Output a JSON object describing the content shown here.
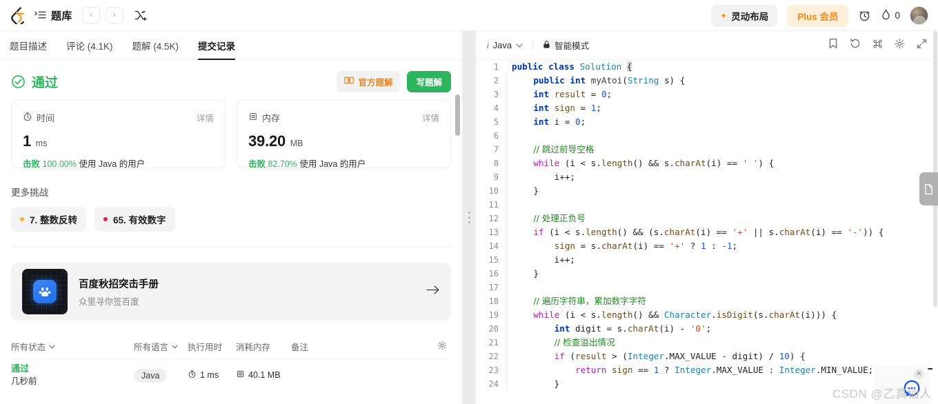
{
  "topbar": {
    "logo_icon": "leetcode-logo-icon",
    "list_icon": "problem-list-icon",
    "nav_title": "题库",
    "prev_label": "‹",
    "next_label": "›",
    "shuffle_icon": "shuffle-icon",
    "layout_label": "灵动布局",
    "spark_icon": "sparkle-icon",
    "plus_label": "Plus 会员",
    "clock_icon": "alarm-clock-icon",
    "drop_icon": "water-drop-icon",
    "drop_count": "0",
    "avatar_icon": "user-avatar"
  },
  "tabs": [
    {
      "label": "题目描述",
      "active": false
    },
    {
      "label": "评论 (4.1K)",
      "active": false
    },
    {
      "label": "题解 (4.5K)",
      "active": false
    },
    {
      "label": "提交记录",
      "active": true
    }
  ],
  "result": {
    "check_icon": "check-circle-icon",
    "status": "通过",
    "official_icon": "book-icon",
    "official_label": "官方题解",
    "write_label": "写题解"
  },
  "stats": [
    {
      "icon": "stopwatch-icon",
      "label": "时间",
      "detail": "详情",
      "value": "1",
      "unit": "ms",
      "beat_prefix": "击败",
      "beat_pct": "100.00%",
      "beat_suffix": "使用 Java 的用户"
    },
    {
      "icon": "memory-chip-icon",
      "label": "内存",
      "detail": "详情",
      "value": "39.20",
      "unit": "MB",
      "beat_prefix": "击败",
      "beat_pct": "82.70%",
      "beat_suffix": "使用 Java 的用户"
    }
  ],
  "more": {
    "title": "更多挑战",
    "chips": [
      {
        "label": "7. 整数反转",
        "dot_color": "#f5b321"
      },
      {
        "label": "65. 有效数字",
        "dot_color": "#ef1b4e"
      }
    ]
  },
  "promo": {
    "thumb_icon": "baidu-bear-paw-icon",
    "title": "百度秋招突击手册",
    "subtitle": "众里寻你签百度",
    "arrow_icon": "arrow-right-icon"
  },
  "submissions": {
    "columns": [
      {
        "label": "所有状态",
        "has_caret": true
      },
      {
        "label": "所有语言",
        "has_caret": true
      },
      {
        "label": "执行用时",
        "has_caret": false
      },
      {
        "label": "消耗内存",
        "has_caret": false
      },
      {
        "label": "备注",
        "has_caret": false
      }
    ],
    "settings_icon": "gear-icon",
    "rows": [
      {
        "status": "通过",
        "time_ago": "几秒前",
        "language": "Java",
        "runtime_icon": "stopwatch-icon",
        "runtime": "1 ms",
        "memory_icon": "memory-chip-icon",
        "memory": "40.1 MB",
        "note": ""
      }
    ]
  },
  "editor": {
    "info_icon": "info-icon",
    "language": "Java",
    "caret_icon": "chevron-down-icon",
    "lock_icon": "lock-icon",
    "mode_label": "智能模式",
    "tools": [
      "bookmark-icon",
      "reset-icon",
      "command-icon",
      "gear-icon",
      "expand-icon"
    ],
    "doc_tab_icon": "document-icon",
    "code_lines": [
      {
        "n": "1",
        "tokens": [
          {
            "t": "kw2",
            "v": "public "
          },
          {
            "t": "kw2",
            "v": "class "
          },
          {
            "t": "cls",
            "v": "Solution "
          },
          {
            "t": "cursor",
            "v": "{"
          }
        ]
      },
      {
        "n": "2",
        "tokens": [
          {
            "t": "pln",
            "v": "    "
          },
          {
            "t": "kw2",
            "v": "public "
          },
          {
            "t": "kw2",
            "v": "int "
          },
          {
            "t": "fn",
            "v": "myAtoi"
          },
          {
            "t": "pln",
            "v": "("
          },
          {
            "t": "cls",
            "v": "String"
          },
          {
            "t": "pln",
            "v": " s) {"
          }
        ]
      },
      {
        "n": "3",
        "tokens": [
          {
            "t": "pln",
            "v": "    "
          },
          {
            "t": "kw2",
            "v": "int "
          },
          {
            "t": "var",
            "v": "result"
          },
          {
            "t": "pln",
            "v": " = "
          },
          {
            "t": "num",
            "v": "0"
          },
          {
            "t": "pln",
            "v": ";"
          }
        ]
      },
      {
        "n": "4",
        "tokens": [
          {
            "t": "pln",
            "v": "    "
          },
          {
            "t": "kw2",
            "v": "int "
          },
          {
            "t": "var",
            "v": "sign"
          },
          {
            "t": "pln",
            "v": " = "
          },
          {
            "t": "num",
            "v": "1"
          },
          {
            "t": "pln",
            "v": ";"
          }
        ]
      },
      {
        "n": "5",
        "tokens": [
          {
            "t": "pln",
            "v": "    "
          },
          {
            "t": "kw2",
            "v": "int "
          },
          {
            "t": "pln",
            "v": "i = "
          },
          {
            "t": "num",
            "v": "0"
          },
          {
            "t": "pln",
            "v": ";"
          }
        ]
      },
      {
        "n": "6",
        "tokens": []
      },
      {
        "n": "7",
        "tokens": [
          {
            "t": "pln",
            "v": "    "
          },
          {
            "t": "cmt",
            "v": "// 跳过前导空格"
          }
        ]
      },
      {
        "n": "8",
        "tokens": [
          {
            "t": "pln",
            "v": "    "
          },
          {
            "t": "kw",
            "v": "while "
          },
          {
            "t": "pln",
            "v": "(i < s."
          },
          {
            "t": "var",
            "v": "length"
          },
          {
            "t": "pln",
            "v": "() && s."
          },
          {
            "t": "var",
            "v": "charAt"
          },
          {
            "t": "pln",
            "v": "(i) == "
          },
          {
            "t": "str",
            "v": "' '"
          },
          {
            "t": "pln",
            "v": ") {"
          }
        ]
      },
      {
        "n": "9",
        "tokens": [
          {
            "t": "pln",
            "v": "        i++;"
          }
        ]
      },
      {
        "n": "10",
        "tokens": [
          {
            "t": "pln",
            "v": "    }"
          }
        ]
      },
      {
        "n": "11",
        "tokens": []
      },
      {
        "n": "12",
        "tokens": [
          {
            "t": "pln",
            "v": "    "
          },
          {
            "t": "cmt",
            "v": "// 处理正负号"
          }
        ]
      },
      {
        "n": "13",
        "tokens": [
          {
            "t": "pln",
            "v": "    "
          },
          {
            "t": "kw",
            "v": "if "
          },
          {
            "t": "pln",
            "v": "(i < s."
          },
          {
            "t": "var",
            "v": "length"
          },
          {
            "t": "pln",
            "v": "() && (s."
          },
          {
            "t": "var",
            "v": "charAt"
          },
          {
            "t": "pln",
            "v": "(i) == "
          },
          {
            "t": "str",
            "v": "'+'"
          },
          {
            "t": "pln",
            "v": " || s."
          },
          {
            "t": "var",
            "v": "charAt"
          },
          {
            "t": "pln",
            "v": "(i) == "
          },
          {
            "t": "str",
            "v": "'-'"
          },
          {
            "t": "pln",
            "v": ")) {"
          }
        ]
      },
      {
        "n": "14",
        "tokens": [
          {
            "t": "pln",
            "v": "        "
          },
          {
            "t": "var",
            "v": "sign"
          },
          {
            "t": "pln",
            "v": " = s."
          },
          {
            "t": "var",
            "v": "charAt"
          },
          {
            "t": "pln",
            "v": "(i) == "
          },
          {
            "t": "str",
            "v": "'+'"
          },
          {
            "t": "pln",
            "v": " ? "
          },
          {
            "t": "num",
            "v": "1"
          },
          {
            "t": "pln",
            "v": " : "
          },
          {
            "t": "num",
            "v": "-1"
          },
          {
            "t": "pln",
            "v": ";"
          }
        ]
      },
      {
        "n": "15",
        "tokens": [
          {
            "t": "pln",
            "v": "        i++;"
          }
        ]
      },
      {
        "n": "16",
        "tokens": [
          {
            "t": "pln",
            "v": "    }"
          }
        ]
      },
      {
        "n": "17",
        "tokens": []
      },
      {
        "n": "18",
        "tokens": [
          {
            "t": "pln",
            "v": "    "
          },
          {
            "t": "cmt",
            "v": "// 遍历字符串，累加数字字符"
          }
        ]
      },
      {
        "n": "19",
        "tokens": [
          {
            "t": "pln",
            "v": "    "
          },
          {
            "t": "kw",
            "v": "while "
          },
          {
            "t": "pln",
            "v": "(i < s."
          },
          {
            "t": "var",
            "v": "length"
          },
          {
            "t": "pln",
            "v": "() && "
          },
          {
            "t": "cls",
            "v": "Character"
          },
          {
            "t": "pln",
            "v": "."
          },
          {
            "t": "var",
            "v": "isDigit"
          },
          {
            "t": "pln",
            "v": "(s."
          },
          {
            "t": "var",
            "v": "charAt"
          },
          {
            "t": "pln",
            "v": "(i))) {"
          }
        ]
      },
      {
        "n": "20",
        "tokens": [
          {
            "t": "pln",
            "v": "        "
          },
          {
            "t": "kw2",
            "v": "int "
          },
          {
            "t": "pln",
            "v": "digit = s."
          },
          {
            "t": "var",
            "v": "charAt"
          },
          {
            "t": "pln",
            "v": "(i) - "
          },
          {
            "t": "str",
            "v": "'0'"
          },
          {
            "t": "pln",
            "v": ";"
          }
        ]
      },
      {
        "n": "21",
        "tokens": [
          {
            "t": "pln",
            "v": "        "
          },
          {
            "t": "cmt",
            "v": "// 检查溢出情况"
          }
        ]
      },
      {
        "n": "22",
        "tokens": [
          {
            "t": "pln",
            "v": "        "
          },
          {
            "t": "kw",
            "v": "if "
          },
          {
            "t": "pln",
            "v": "("
          },
          {
            "t": "var",
            "v": "result"
          },
          {
            "t": "pln",
            "v": " > ("
          },
          {
            "t": "cls",
            "v": "Integer"
          },
          {
            "t": "pln",
            "v": ".MAX_VALUE - digit) / "
          },
          {
            "t": "num",
            "v": "10"
          },
          {
            "t": "pln",
            "v": ") {"
          }
        ]
      },
      {
        "n": "23",
        "tokens": [
          {
            "t": "pln",
            "v": "            "
          },
          {
            "t": "kw",
            "v": "return "
          },
          {
            "t": "var",
            "v": "sign"
          },
          {
            "t": "pln",
            "v": " == "
          },
          {
            "t": "num",
            "v": "1"
          },
          {
            "t": "pln",
            "v": " ? "
          },
          {
            "t": "cls",
            "v": "Integer"
          },
          {
            "t": "pln",
            "v": ".MAX_VALUE : "
          },
          {
            "t": "cls",
            "v": "Integer"
          },
          {
            "t": "pln",
            "v": ".MIN_VALUE;"
          }
        ]
      },
      {
        "n": "24",
        "tokens": [
          {
            "t": "pln",
            "v": "        }"
          }
        ]
      }
    ]
  },
  "overlay": {
    "watermark": "CSDN @乙真仙人",
    "chat_icon": "chat-bubble-icon",
    "close_icon": "close-icon"
  }
}
